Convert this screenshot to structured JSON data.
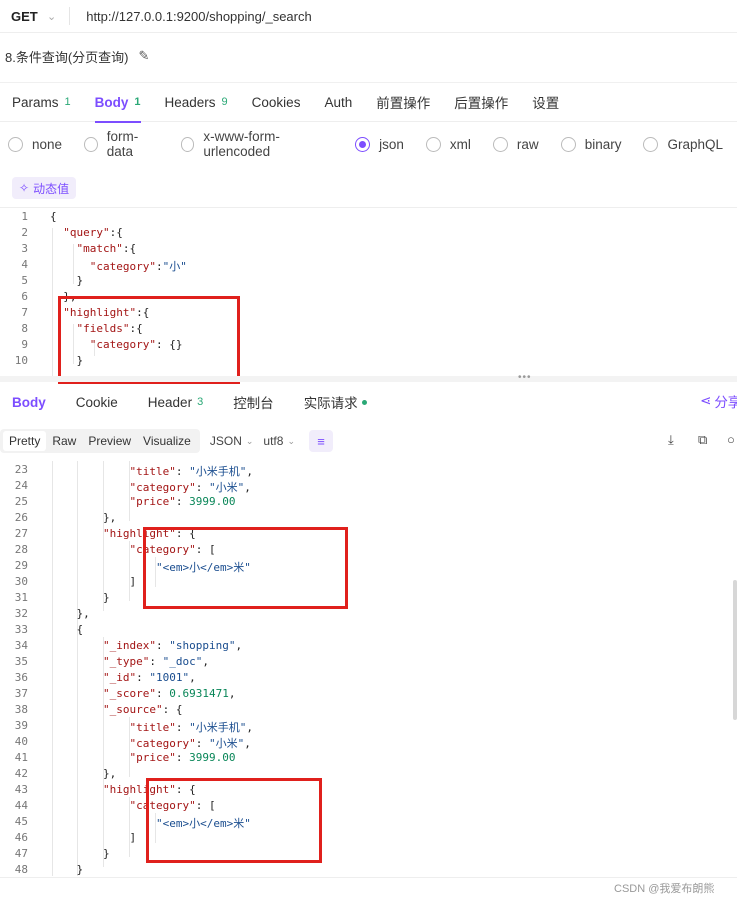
{
  "request": {
    "method": "GET",
    "url": "http://127.0.0.1:9200/shopping/_search",
    "title": "8.条件查询(分页查询)"
  },
  "request_tabs": [
    {
      "label": "Params",
      "count": "1"
    },
    {
      "label": "Body",
      "count": "1"
    },
    {
      "label": "Headers",
      "count": "9"
    },
    {
      "label": "Cookies",
      "count": ""
    },
    {
      "label": "Auth",
      "count": ""
    },
    {
      "label": "前置操作",
      "count": ""
    },
    {
      "label": "后置操作",
      "count": ""
    },
    {
      "label": "设置",
      "count": ""
    }
  ],
  "body_types": [
    "none",
    "form-data",
    "x-www-form-urlencoded",
    "json",
    "xml",
    "raw",
    "binary",
    "GraphQL"
  ],
  "selected_body_type": "json",
  "dynamic_value_label": "动态值",
  "request_body_lines": [
    {
      "n": "1",
      "text": "{"
    },
    {
      "n": "2",
      "text": "  \"query\":{"
    },
    {
      "n": "3",
      "text": "    \"match\":{"
    },
    {
      "n": "4",
      "text": "      \"category\":\"小\""
    },
    {
      "n": "5",
      "text": "    }"
    },
    {
      "n": "6",
      "text": "  },"
    },
    {
      "n": "7",
      "text": "  \"highlight\":{"
    },
    {
      "n": "8",
      "text": "    \"fields\":{"
    },
    {
      "n": "9",
      "text": "      \"category\": {}"
    },
    {
      "n": "10",
      "text": "    }"
    }
  ],
  "response_tabs": [
    {
      "label": "Body",
      "count": ""
    },
    {
      "label": "Cookie",
      "count": ""
    },
    {
      "label": "Header",
      "count": "3"
    },
    {
      "label": "控制台",
      "count": ""
    },
    {
      "label": "实际请求",
      "count": ""
    }
  ],
  "share_label": "分享",
  "view_modes": [
    "Pretty",
    "Raw",
    "Preview",
    "Visualize"
  ],
  "format_select": "JSON",
  "encoding_select": "utf8",
  "response_lines": [
    {
      "n": "23",
      "text": "            \"title\": \"小米手机\","
    },
    {
      "n": "24",
      "text": "            \"category\": \"小米\","
    },
    {
      "n": "25",
      "text": "            \"price\": 3999.00"
    },
    {
      "n": "26",
      "text": "        },"
    },
    {
      "n": "27",
      "text": "        \"highlight\": {"
    },
    {
      "n": "28",
      "text": "            \"category\": ["
    },
    {
      "n": "29",
      "text": "                \"<em>小</em>米\""
    },
    {
      "n": "30",
      "text": "            ]"
    },
    {
      "n": "31",
      "text": "        }"
    },
    {
      "n": "32",
      "text": "    },"
    },
    {
      "n": "33",
      "text": "    {"
    },
    {
      "n": "34",
      "text": "        \"_index\": \"shopping\","
    },
    {
      "n": "35",
      "text": "        \"_type\": \"_doc\","
    },
    {
      "n": "36",
      "text": "        \"_id\": \"1001\","
    },
    {
      "n": "37",
      "text": "        \"_score\": 0.6931471,"
    },
    {
      "n": "38",
      "text": "        \"_source\": {"
    },
    {
      "n": "39",
      "text": "            \"title\": \"小米手机\","
    },
    {
      "n": "40",
      "text": "            \"category\": \"小米\","
    },
    {
      "n": "41",
      "text": "            \"price\": 3999.00"
    },
    {
      "n": "42",
      "text": "        },"
    },
    {
      "n": "43",
      "text": "        \"highlight\": {"
    },
    {
      "n": "44",
      "text": "            \"category\": ["
    },
    {
      "n": "45",
      "text": "                \"<em>小</em>米\""
    },
    {
      "n": "46",
      "text": "            ]"
    },
    {
      "n": "47",
      "text": "        }"
    },
    {
      "n": "48",
      "text": "    }"
    }
  ],
  "watermark": "CSDN @我爱布朗熊",
  "colors": {
    "accent": "#7c4dff",
    "count_green": "#2aa876",
    "highlight_box": "#e0201c"
  }
}
